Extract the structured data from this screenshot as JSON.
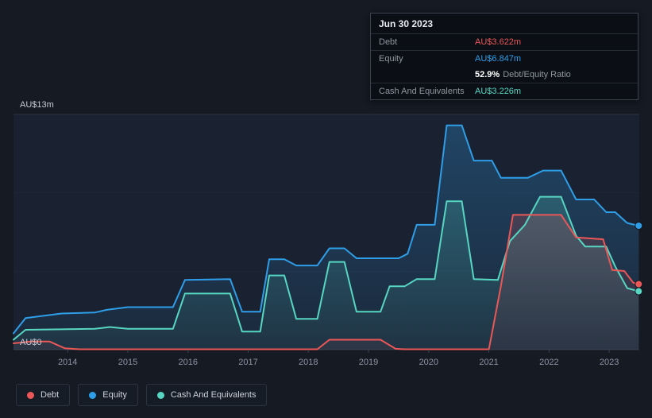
{
  "tooltip": {
    "date": "Jun 30 2023",
    "debt": {
      "label": "Debt",
      "value": "AU$3.622m",
      "color": "#eb5757"
    },
    "equity": {
      "label": "Equity",
      "value": "AU$6.847m",
      "color": "#2f9ee8"
    },
    "ratio": {
      "value": "52.9%",
      "label": "Debt/Equity Ratio"
    },
    "cash": {
      "label": "Cash And Equivalents",
      "value": "AU$3.226m",
      "color": "#57d6c2"
    }
  },
  "legend": {
    "items": [
      {
        "label": "Debt",
        "color": "#eb5757"
      },
      {
        "label": "Equity",
        "color": "#2f9ee8"
      },
      {
        "label": "Cash And Equivalents",
        "color": "#57d6c2"
      }
    ]
  },
  "chart_data": {
    "type": "area",
    "x_range": [
      2013.1,
      2023.5
    ],
    "y_range": [
      0,
      13
    ],
    "y_axis": {
      "max_label": "AU$13m",
      "min_label": "AU$0"
    },
    "x_ticks": [
      "2014",
      "2015",
      "2016",
      "2017",
      "2018",
      "2019",
      "2020",
      "2021",
      "2022",
      "2023"
    ],
    "grid": true,
    "legend_position": "bottom-left",
    "series": [
      {
        "name": "Equity",
        "color": "#2f9ee8",
        "points": [
          [
            2013.1,
            0.9
          ],
          [
            2013.3,
            1.75
          ],
          [
            2013.9,
            2.0
          ],
          [
            2014.45,
            2.05
          ],
          [
            2014.65,
            2.2
          ],
          [
            2015.0,
            2.35
          ],
          [
            2015.75,
            2.35
          ],
          [
            2015.95,
            3.85
          ],
          [
            2016.7,
            3.9
          ],
          [
            2016.9,
            2.1
          ],
          [
            2017.2,
            2.1
          ],
          [
            2017.35,
            5.0
          ],
          [
            2017.6,
            5.0
          ],
          [
            2017.8,
            4.65
          ],
          [
            2018.15,
            4.65
          ],
          [
            2018.35,
            5.6
          ],
          [
            2018.6,
            5.6
          ],
          [
            2018.8,
            5.05
          ],
          [
            2019.5,
            5.05
          ],
          [
            2019.65,
            5.3
          ],
          [
            2019.8,
            6.9
          ],
          [
            2020.1,
            6.9
          ],
          [
            2020.3,
            12.4
          ],
          [
            2020.55,
            12.4
          ],
          [
            2020.75,
            10.45
          ],
          [
            2021.05,
            10.45
          ],
          [
            2021.2,
            9.5
          ],
          [
            2021.65,
            9.5
          ],
          [
            2021.9,
            9.9
          ],
          [
            2022.2,
            9.9
          ],
          [
            2022.45,
            8.3
          ],
          [
            2022.75,
            8.3
          ],
          [
            2022.95,
            7.6
          ],
          [
            2023.1,
            7.6
          ],
          [
            2023.3,
            7.0
          ],
          [
            2023.49,
            6.847
          ]
        ]
      },
      {
        "name": "Cash And Equivalents",
        "color": "#57d6c2",
        "points": [
          [
            2013.1,
            0.55
          ],
          [
            2013.3,
            1.1
          ],
          [
            2014.45,
            1.15
          ],
          [
            2014.7,
            1.25
          ],
          [
            2015.0,
            1.15
          ],
          [
            2015.75,
            1.15
          ],
          [
            2015.95,
            3.1
          ],
          [
            2016.7,
            3.1
          ],
          [
            2016.9,
            1.0
          ],
          [
            2017.2,
            1.0
          ],
          [
            2017.35,
            4.1
          ],
          [
            2017.6,
            4.1
          ],
          [
            2017.8,
            1.7
          ],
          [
            2018.15,
            1.7
          ],
          [
            2018.35,
            4.85
          ],
          [
            2018.6,
            4.85
          ],
          [
            2018.8,
            2.1
          ],
          [
            2019.2,
            2.1
          ],
          [
            2019.35,
            3.5
          ],
          [
            2019.6,
            3.5
          ],
          [
            2019.8,
            3.9
          ],
          [
            2020.1,
            3.9
          ],
          [
            2020.3,
            8.2
          ],
          [
            2020.55,
            8.2
          ],
          [
            2020.75,
            3.9
          ],
          [
            2021.15,
            3.85
          ],
          [
            2021.35,
            6.0
          ],
          [
            2021.6,
            6.9
          ],
          [
            2021.85,
            8.45
          ],
          [
            2022.2,
            8.45
          ],
          [
            2022.45,
            6.3
          ],
          [
            2022.6,
            5.7
          ],
          [
            2022.95,
            5.7
          ],
          [
            2023.1,
            4.6
          ],
          [
            2023.3,
            3.4
          ],
          [
            2023.49,
            3.226
          ]
        ]
      },
      {
        "name": "Debt",
        "color": "#eb5757",
        "points": [
          [
            2013.1,
            0.35
          ],
          [
            2013.4,
            0.45
          ],
          [
            2013.7,
            0.45
          ],
          [
            2013.95,
            0.08
          ],
          [
            2014.2,
            0.02
          ],
          [
            2018.15,
            0.02
          ],
          [
            2018.35,
            0.55
          ],
          [
            2019.2,
            0.55
          ],
          [
            2019.45,
            0.05
          ],
          [
            2019.6,
            0.02
          ],
          [
            2021.0,
            0.02
          ],
          [
            2021.2,
            3.5
          ],
          [
            2021.4,
            7.45
          ],
          [
            2022.2,
            7.45
          ],
          [
            2022.45,
            6.2
          ],
          [
            2022.9,
            6.1
          ],
          [
            2023.05,
            4.4
          ],
          [
            2023.25,
            4.35
          ],
          [
            2023.4,
            3.7
          ],
          [
            2023.49,
            3.622
          ]
        ]
      }
    ]
  }
}
